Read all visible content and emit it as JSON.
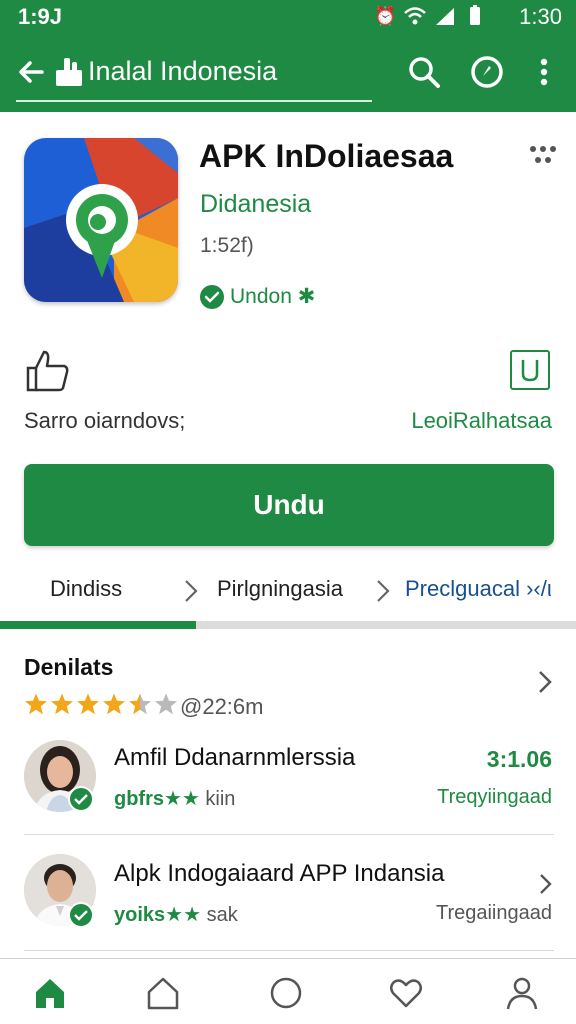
{
  "status_bar": {
    "time_left": "1:9J",
    "time_right": "1:30"
  },
  "app_bar": {
    "title": "Inalal Indonesia"
  },
  "app": {
    "name": "APK InDoliaesaa",
    "developer": "Didanesia",
    "version": "1:52f)",
    "verified_label": "Undon ✱"
  },
  "actions": {
    "like_label": "Sarro oiarndovs;",
    "save_label": "LeoiRalhatsaa"
  },
  "install_label": "Undu",
  "tabs": [
    {
      "label": "Dindiss"
    },
    {
      "label": "Pirlgningasia"
    },
    {
      "label": "Preclguacal ›‹/ι"
    }
  ],
  "progress": 0.34,
  "details": {
    "title": "Denilats",
    "rating": 4.5,
    "rating_count": "@22:6m"
  },
  "reviews": [
    {
      "name": "Amfil Ddanarnmlerssia",
      "stars_text": "gbfrs★★",
      "sub_text": "kiin",
      "right_top": "3:1.06",
      "right_bottom": "Treqyiingaad"
    },
    {
      "name": "Alpk Indogaiaard APP Indansia",
      "stars_text": "yoiks★★",
      "sub_text": "sak",
      "right_top": "",
      "right_bottom": "Tregaiingaad"
    }
  ],
  "colors": {
    "brand_green": "#1e8a43",
    "link_blue": "#1a4f8f",
    "star_gold": "#f2a71b"
  },
  "icons": [
    "back-arrow-icon",
    "thumbs-up-icon",
    "search-icon",
    "compass-icon",
    "more-vert-icon",
    "home-icon",
    "house-outline-icon",
    "circle-icon",
    "heart-icon",
    "person-icon"
  ]
}
